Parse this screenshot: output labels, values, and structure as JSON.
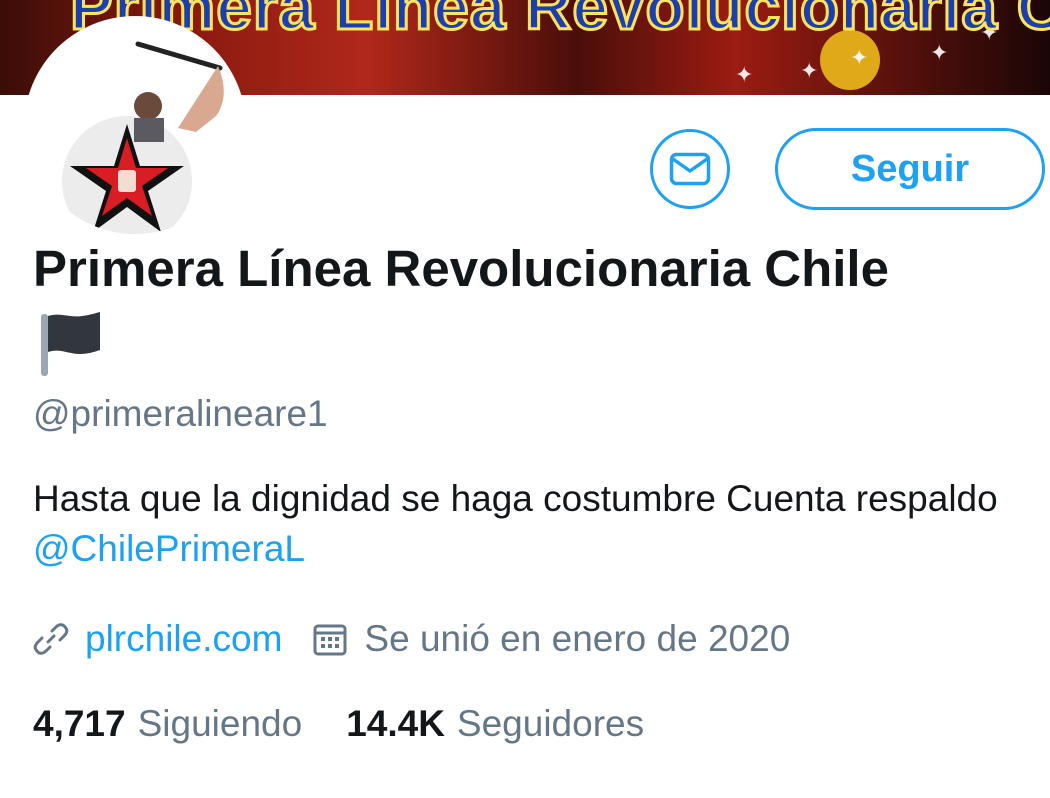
{
  "banner": {
    "text": "Primera Línea Revolucionaria Chile",
    "icon": "banner-image"
  },
  "avatar": {
    "icon": "red-black-star-fist-logo"
  },
  "actions": {
    "message_icon": "envelope-icon",
    "follow_label": "Seguir"
  },
  "profile": {
    "display_name": "Primera Línea Revolucionaria Chile",
    "name_emoji": "black-flag",
    "handle": "@primeralineare1",
    "bio_text": "Hasta que la dignidad se haga costumbre  Cuenta respaldo ",
    "bio_mention": "@ChilePrimeraL",
    "website": "plrchile.com",
    "joined": "Se unió en enero de 2020"
  },
  "stats": {
    "following_count": "4,717",
    "following_label": "Siguiendo",
    "followers_count": "14.4K",
    "followers_label": "Seguidores"
  },
  "colors": {
    "accent": "#1da1f2",
    "text": "#14171a",
    "secondary": "#657786"
  }
}
